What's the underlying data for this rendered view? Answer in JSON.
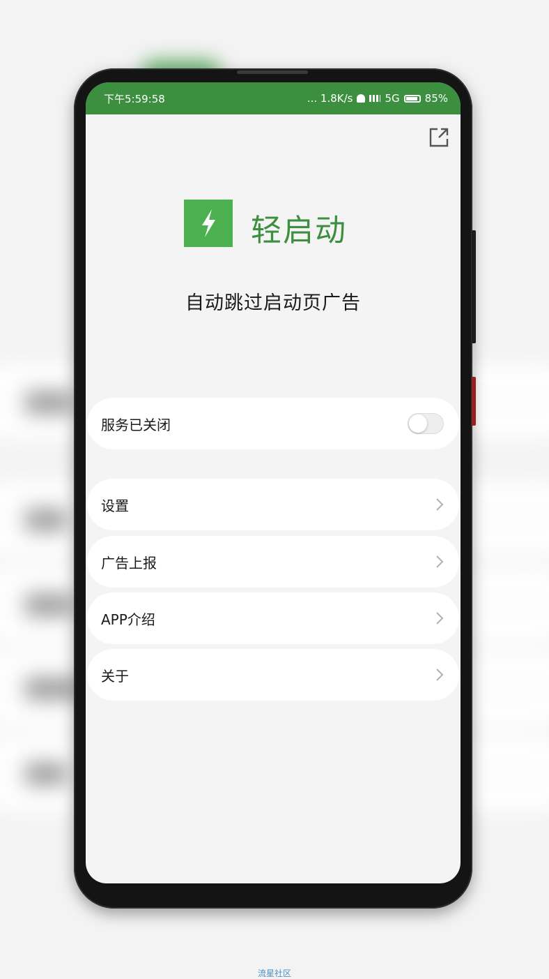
{
  "status_bar": {
    "time": "下午5:59:58",
    "network_speed": "... 1.8K/s",
    "network_type": "5G",
    "battery": "85%"
  },
  "app": {
    "name": "轻启动",
    "tagline": "自动跳过启动页广告"
  },
  "service": {
    "label": "服务已关闭",
    "enabled": false
  },
  "menu": {
    "settings": "设置",
    "ad_report": "广告上报",
    "app_intro": "APP介绍",
    "about": "关于"
  },
  "watermark": "流星社区",
  "colors": {
    "accent": "#3b8f3f",
    "logo": "#4caf50",
    "background": "#f4f4f4"
  }
}
